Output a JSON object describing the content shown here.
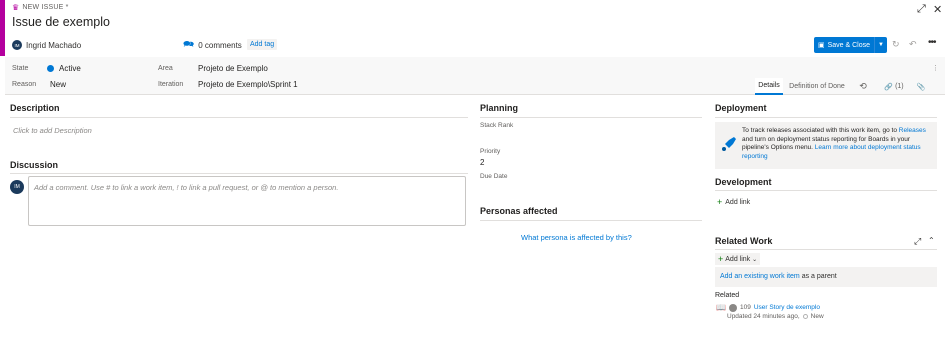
{
  "colors": {
    "accent": "#b4009e",
    "primary": "#0078d4",
    "state_active": "#0078d4"
  },
  "header": {
    "type_label": "NEW ISSUE *",
    "type_icon": "issue-crown-icon",
    "title": "Issue de exemplo",
    "assignee": {
      "initials": "IM",
      "name": "Ingrid Machado"
    },
    "comments_label": "0 comments",
    "add_tag_label": "Add tag",
    "save_label": "Save & Close"
  },
  "fields": {
    "state_label": "State",
    "state_value": "Active",
    "reason_label": "Reason",
    "reason_value": "New",
    "area_label": "Area",
    "area_value": "Projeto de Exemplo",
    "iteration_label": "Iteration",
    "iteration_value": "Projeto de Exemplo\\Sprint 1"
  },
  "tabs": {
    "details": "Details",
    "dod": "Definition of Done",
    "links": "(1)"
  },
  "description": {
    "title": "Description",
    "placeholder": "Click to add Description"
  },
  "discussion": {
    "title": "Discussion",
    "avatar_initials": "IM",
    "placeholder": "Add a comment. Use # to link a work item, ! to link a pull request, or @ to mention a person."
  },
  "planning": {
    "title": "Planning",
    "stack_rank_label": "Stack Rank",
    "priority_label": "Priority",
    "priority_value": "2",
    "due_date_label": "Due Date"
  },
  "personas": {
    "title": "Personas affected",
    "link": "What persona is affected by this?"
  },
  "deployment": {
    "title": "Deployment",
    "text_1": "To track releases associated with this work item, go to",
    "link_releases": "Releases",
    "text_2": "and turn on deployment status reporting for Boards in your pipeline's Options menu.",
    "link_learn": "Learn more about deployment status reporting"
  },
  "development": {
    "title": "Development",
    "add_link": "Add link"
  },
  "related_work": {
    "title": "Related Work",
    "add_link": "Add link",
    "existing_link": "Add an existing work item",
    "existing_suffix": "as a parent",
    "related_label": "Related",
    "item_id": "109",
    "item_title": "User Story de exemplo",
    "item_updated": "Updated 24 minutes ago,",
    "item_state": "New"
  }
}
